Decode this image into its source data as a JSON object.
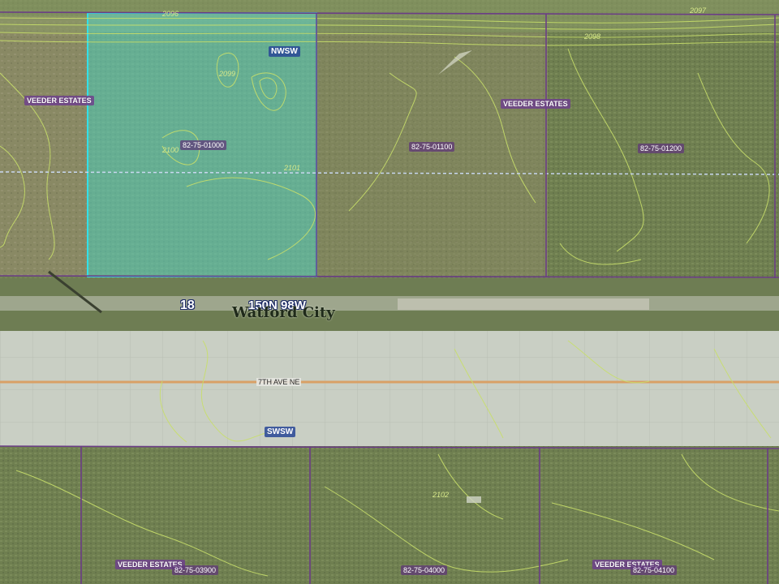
{
  "map": {
    "section_number": "18",
    "township_range": "150N 98W",
    "city_label": "Watford City",
    "road_label": "7TH AVE NE",
    "quarter_labels": [
      "NWSW",
      "SWSW"
    ],
    "subdivision_labels": [
      "VEEDER ESTATES",
      "VEEDER ESTATES",
      "VEEDER ESTATES",
      "VEEDER ESTATES"
    ],
    "parcels": {
      "p1": "82-75-01000",
      "p2": "82-75-01100",
      "p3": "82-75-01200",
      "p4": "82-75-03900",
      "p5": "82-75-04000",
      "p6": "82-75-04100"
    },
    "contour_values": [
      "2096",
      "2097",
      "2098",
      "2099",
      "2100",
      "2101",
      "2102"
    ],
    "colors": {
      "highlight_fill": "#5fd6c8",
      "highlight_stroke": "#33e0e8",
      "parcel_line": "#6b3d86",
      "contour": "#c8df6a",
      "road_centerline": "#d9a066",
      "section_line": "#c9d8f0"
    }
  }
}
